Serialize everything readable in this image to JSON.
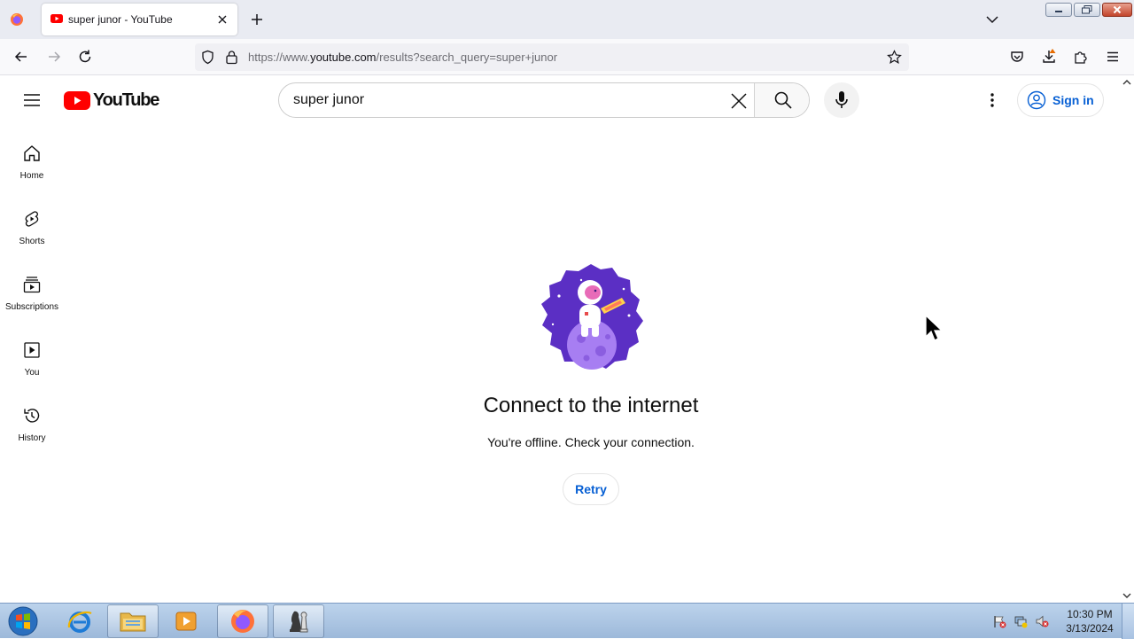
{
  "browser": {
    "tab": {
      "title": "super junor - YouTube",
      "favicon": "youtube-favicon"
    },
    "url": {
      "prefix": "https://www.",
      "host": "youtube.com",
      "path": "/results?search_query=super+junor"
    },
    "icons": [
      "firefox-icon",
      "back-icon",
      "forward-icon",
      "reload-icon",
      "shield-icon",
      "lock-icon",
      "star-icon",
      "pocket-icon",
      "download-icon",
      "extensions-icon",
      "menu-icon"
    ]
  },
  "youtube": {
    "logo_text": "YouTube",
    "search": {
      "value": "super junor"
    },
    "signin_label": "Sign in",
    "sidebar": {
      "items": [
        {
          "label": "Home",
          "icon": "home-icon"
        },
        {
          "label": "Shorts",
          "icon": "shorts-icon"
        },
        {
          "label": "Subscriptions",
          "icon": "subscriptions-icon"
        },
        {
          "label": "You",
          "icon": "you-icon"
        },
        {
          "label": "History",
          "icon": "history-icon"
        }
      ]
    },
    "offline": {
      "title": "Connect to the internet",
      "subtitle": "You're offline. Check your connection.",
      "retry_label": "Retry"
    },
    "colors": {
      "brand_red": "#ff0000",
      "link_blue": "#065fd4",
      "illustration_purple": "#5b2fc4"
    }
  },
  "taskbar": {
    "apps": [
      "internet-explorer-icon",
      "file-explorer-icon",
      "media-player-icon",
      "firefox-icon",
      "chess-icon"
    ],
    "clock": {
      "time": "10:30 PM",
      "date": "3/13/2024"
    }
  }
}
